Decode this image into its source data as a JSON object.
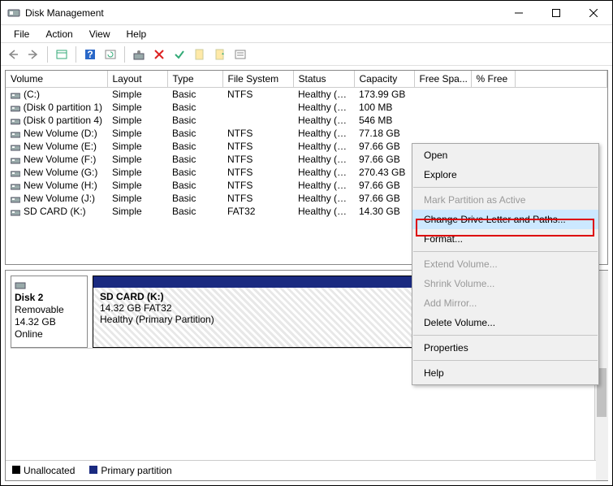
{
  "window": {
    "title": "Disk Management"
  },
  "menu": {
    "file": "File",
    "action": "Action",
    "view": "View",
    "help": "Help"
  },
  "columns": {
    "volume": "Volume",
    "layout": "Layout",
    "type": "Type",
    "fs": "File System",
    "status": "Status",
    "capacity": "Capacity",
    "free": "Free Spa...",
    "pct": "% Free"
  },
  "volumes": [
    {
      "name": "(C:)",
      "layout": "Simple",
      "type": "Basic",
      "fs": "NTFS",
      "status": "Healthy (B...",
      "capacity": "173.99 GB"
    },
    {
      "name": "(Disk 0 partition 1)",
      "layout": "Simple",
      "type": "Basic",
      "fs": "",
      "status": "Healthy (E...",
      "capacity": "100 MB"
    },
    {
      "name": "(Disk 0 partition 4)",
      "layout": "Simple",
      "type": "Basic",
      "fs": "",
      "status": "Healthy (R...",
      "capacity": "546 MB"
    },
    {
      "name": "New Volume (D:)",
      "layout": "Simple",
      "type": "Basic",
      "fs": "NTFS",
      "status": "Healthy (B...",
      "capacity": "77.18 GB"
    },
    {
      "name": "New Volume (E:)",
      "layout": "Simple",
      "type": "Basic",
      "fs": "NTFS",
      "status": "Healthy (B...",
      "capacity": "97.66 GB"
    },
    {
      "name": "New Volume (F:)",
      "layout": "Simple",
      "type": "Basic",
      "fs": "NTFS",
      "status": "Healthy (B...",
      "capacity": "97.66 GB"
    },
    {
      "name": "New Volume (G:)",
      "layout": "Simple",
      "type": "Basic",
      "fs": "NTFS",
      "status": "Healthy (B...",
      "capacity": "270.43 GB"
    },
    {
      "name": "New Volume (H:)",
      "layout": "Simple",
      "type": "Basic",
      "fs": "NTFS",
      "status": "Healthy (B...",
      "capacity": "97.66 GB"
    },
    {
      "name": "New Volume (J:)",
      "layout": "Simple",
      "type": "Basic",
      "fs": "NTFS",
      "status": "Healthy (B...",
      "capacity": "97.66 GB"
    },
    {
      "name": "SD CARD (K:)",
      "layout": "Simple",
      "type": "Basic",
      "fs": "FAT32",
      "status": "Healthy (P...",
      "capacity": "14.30 GB"
    }
  ],
  "disk": {
    "title": "Disk 2",
    "kind": "Removable",
    "size": "14.32 GB",
    "state": "Online",
    "part_name": "SD CARD  (K:)",
    "part_info": "14.32 GB FAT32",
    "part_status": "Healthy (Primary Partition)"
  },
  "legend": {
    "unalloc": "Unallocated",
    "primary": "Primary partition"
  },
  "ctx": {
    "open": "Open",
    "explore": "Explore",
    "mark": "Mark Partition as Active",
    "change": "Change Drive Letter and Paths...",
    "format": "Format...",
    "extend": "Extend Volume...",
    "shrink": "Shrink Volume...",
    "mirror": "Add Mirror...",
    "delete": "Delete Volume...",
    "props": "Properties",
    "help": "Help"
  }
}
